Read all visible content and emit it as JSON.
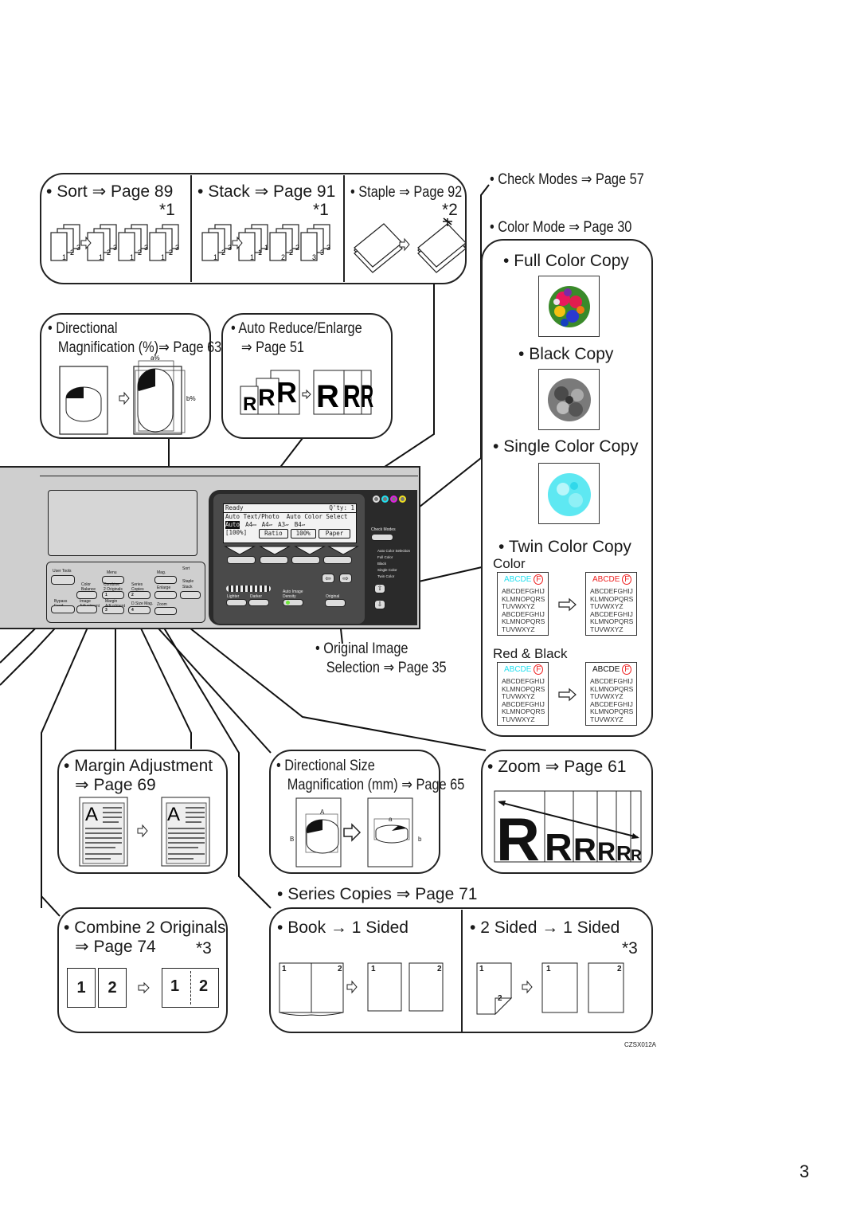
{
  "page_number": "3",
  "figure_id": "CZSX012A",
  "finishing": {
    "sort": {
      "label": "Sort",
      "ref": "Page 89",
      "note": "*1"
    },
    "stack": {
      "label": "Stack",
      "ref": "Page 91",
      "note": "*1"
    },
    "staple": {
      "label": "Staple",
      "ref": "Page 92",
      "note": "*2"
    },
    "sort_pages": [
      "1",
      "2",
      "3"
    ],
    "stack_pages": [
      "1",
      "1",
      "1",
      "2",
      "2",
      "2",
      "3",
      "3",
      "3"
    ]
  },
  "check_modes": {
    "label": "Check Modes",
    "ref": "Page 57"
  },
  "color_mode": {
    "label": "Color Mode",
    "ref": "Page 30",
    "full_color": "Full Color Copy",
    "black": "Black Copy",
    "single_color": "Single Color Copy",
    "twin_color": "Twin Color Copy",
    "twin_color_sub": "Color",
    "red_black_sub": "Red & Black",
    "sample_heading": "ABCDE",
    "sample_badge": "F",
    "sample_lines": [
      "ABCDEFGHIJ",
      "KLMNOPQRS",
      "TUVWXYZ",
      "ABCDEFGHIJ",
      "KLMNOPQRS",
      "TUVWXYZ"
    ],
    "colors": {
      "cyan": "#22e0f0",
      "red": "#ee2222",
      "black": "#111111"
    }
  },
  "directional_mag": {
    "line1": "Directional",
    "line2": "Magnification (%)",
    "ref": "Page 63",
    "a_label": "a%",
    "b_label": "b%"
  },
  "auto_reduce": {
    "label": "Auto Reduce/Enlarge",
    "ref": "Page 51",
    "glyph": "R"
  },
  "control_panel": {
    "lcd": {
      "status": "Ready",
      "qty": "Q'ty:  1",
      "mode": "Auto Text/Photo",
      "color_select": "Auto Color Select",
      "paper_auto": "Auto",
      "paper_sizes": [
        "A4▭",
        "A4▱",
        "A3▱",
        "B4▱"
      ],
      "ratio_value": "[100%]",
      "softkeys": [
        "Ratio",
        "100%",
        "Paper"
      ]
    },
    "left_buttons": {
      "user_tools": "User Tools",
      "menu": "Menu",
      "color_balance_1": "Color",
      "color_balance_2": "Balance",
      "combine_1": "Combine",
      "combine_2": "2 Originals",
      "series_1": "Series",
      "series_2": "Copies",
      "bypass_1": "Bypass",
      "bypass_2": "Feed",
      "image_adj_1": "Image",
      "image_adj_2": "Adjustment",
      "margin_1": "Margin",
      "margin_2": "Adjustment",
      "size_mag": "D.Size Mag.",
      "zoom": "Zoom",
      "dir_mag": "Mag.",
      "auto_re": "Enlarge",
      "sort": "Sort",
      "staple": "Staple",
      "stack": "Stack",
      "num1": "1",
      "num2": "2",
      "num3": "3",
      "num4": "4"
    },
    "density": {
      "lighter": "Lighter",
      "darker": "Darker",
      "auto": "Auto Image Density"
    },
    "original": "Original",
    "check": "Check Modes",
    "color_list": [
      "Auto Color Selection",
      "Full Color",
      "Black",
      "Single Color",
      "Twin Color"
    ]
  },
  "original_image": {
    "line1": "Original Image",
    "line2": "Selection",
    "ref": "Page 35"
  },
  "margin_adjustment": {
    "label": "Margin Adjustment",
    "ref": "Page 69",
    "glyph": "A"
  },
  "directional_size": {
    "line1": "Directional Size",
    "line2": "Magnification (mm)",
    "ref": "Page 65",
    "A": "A",
    "B": "B",
    "a": "a",
    "b": "b"
  },
  "zoom": {
    "label": "Zoom",
    "ref": "Page 61",
    "glyph": "R"
  },
  "series_copies": {
    "label": "Series Copies",
    "ref": "Page 71"
  },
  "combine": {
    "line1": "Combine 2 Originals",
    "ref": "Page 74",
    "note": "*3",
    "p1": "1",
    "p2": "2"
  },
  "book": {
    "label": "Book",
    "target": "1 Sided",
    "p1": "1",
    "p2": "2"
  },
  "two_sided": {
    "label": "2 Sided",
    "target": "1 Sided",
    "note": "*3",
    "p1": "1",
    "p2": "2"
  },
  "symbols": {
    "bullet": "•",
    "ref_arrow": "⇒",
    "to_arrow": "→"
  }
}
